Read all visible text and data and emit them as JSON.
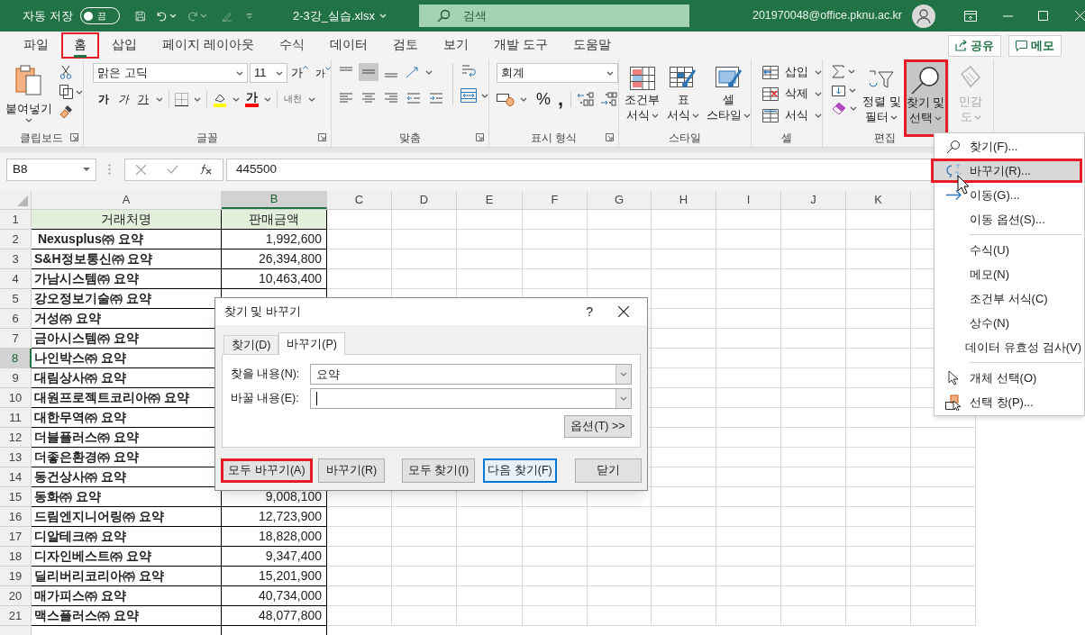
{
  "title_bar": {
    "autosave_label": "자동 저장",
    "autosave": {
      "on": false,
      "label": "끔"
    },
    "filename": "2-3강_실습.xlsx",
    "search": {
      "placeholder": "검색"
    },
    "account": "201970048@office.pknu.ac.kr"
  },
  "menu_tabs": [
    {
      "label": "파일",
      "selected": false,
      "highlighted": false
    },
    {
      "label": "홈",
      "selected": true,
      "highlighted": true
    },
    {
      "label": "삽입",
      "selected": false,
      "highlighted": false
    },
    {
      "label": "페이지 레이아웃",
      "selected": false,
      "highlighted": false
    },
    {
      "label": "수식",
      "selected": false,
      "highlighted": false
    },
    {
      "label": "데이터",
      "selected": false,
      "highlighted": false
    },
    {
      "label": "검토",
      "selected": false,
      "highlighted": false
    },
    {
      "label": "보기",
      "selected": false,
      "highlighted": false
    },
    {
      "label": "개발 도구",
      "selected": false,
      "highlighted": false
    },
    {
      "label": "도움말",
      "selected": false,
      "highlighted": false
    }
  ],
  "share_button": "공유",
  "comment_button": "메모",
  "ribbon": {
    "clipboard": {
      "paste": "붙여넣기",
      "group_label": "클립보드"
    },
    "font": {
      "font_name": "맑은 고딕",
      "font_size": "11",
      "grow": "가",
      "shrink": "가",
      "bold": "가",
      "italic": "가",
      "underline": "가",
      "font_color": "가",
      "phonetic": "내천",
      "group_label": "글꼴"
    },
    "alignment": {
      "group_label": "맞춤"
    },
    "number": {
      "format": "회계",
      "percent": "%",
      "comma": ",",
      "group_label": "표시 형식"
    },
    "styles": {
      "buttons": [
        {
          "lines": [
            "조건부",
            "서식"
          ]
        },
        {
          "lines": [
            "표",
            "서식"
          ]
        },
        {
          "lines": [
            "셀",
            "스타일"
          ]
        }
      ],
      "group_label": "스타일"
    },
    "cells": {
      "buttons": [
        {
          "kind": "insert",
          "label": "삽입"
        },
        {
          "kind": "delete",
          "label": "삭제"
        },
        {
          "kind": "format",
          "label": "서식"
        }
      ],
      "group_label": "셀"
    },
    "editing": {
      "sort_filter": {
        "lines": [
          "정렬 및",
          "필터"
        ]
      },
      "find_select": {
        "lines": [
          "찾기 및",
          "선택"
        ],
        "highlighted": true,
        "expanded": true
      },
      "group_label": "편집"
    },
    "sensitivity": {
      "lines": [
        "민감",
        "도"
      ],
      "disabled": true
    }
  },
  "formula_bar": {
    "name_box": "B8",
    "formula": "445500"
  },
  "sheet": {
    "columns": [
      {
        "label": "A",
        "selected": false
      },
      {
        "label": "B",
        "selected": true
      },
      {
        "label": "C",
        "selected": false
      },
      {
        "label": "D",
        "selected": false
      },
      {
        "label": "E",
        "selected": false
      },
      {
        "label": "F",
        "selected": false
      },
      {
        "label": "G",
        "selected": false
      },
      {
        "label": "H",
        "selected": false
      },
      {
        "label": "I",
        "selected": false
      },
      {
        "label": "J",
        "selected": false
      },
      {
        "label": "K",
        "selected": false
      }
    ],
    "rows": [
      {
        "number": "1",
        "selected": false,
        "kind": "header",
        "cells": [
          "거래처명",
          "판매금액"
        ]
      },
      {
        "number": "2",
        "selected": false,
        "kind": "data",
        "cells": [
          " Nexusplus㈜ 요약",
          "1,992,600"
        ]
      },
      {
        "number": "3",
        "selected": false,
        "kind": "data",
        "cells": [
          "S&H정보통신㈜ 요약",
          "26,394,800"
        ]
      },
      {
        "number": "4",
        "selected": false,
        "kind": "data",
        "cells": [
          "가남시스템㈜ 요약",
          "10,463,400"
        ]
      },
      {
        "number": "5",
        "selected": false,
        "kind": "data",
        "cells": [
          "강오정보기술㈜ 요약"
        ]
      },
      {
        "number": "6",
        "selected": false,
        "kind": "data",
        "cells": [
          "거성㈜ 요약"
        ]
      },
      {
        "number": "7",
        "selected": false,
        "kind": "data",
        "cells": [
          "금아시스템㈜ 요약"
        ]
      },
      {
        "number": "8",
        "selected": true,
        "kind": "data",
        "cells": [
          "나인박스㈜ 요약"
        ]
      },
      {
        "number": "9",
        "selected": false,
        "kind": "data",
        "cells": [
          "대림상사㈜ 요약"
        ]
      },
      {
        "number": "10",
        "selected": false,
        "kind": "data",
        "cells": [
          "대원프로젝트코리아㈜ 요약"
        ]
      },
      {
        "number": "11",
        "selected": false,
        "kind": "data",
        "cells": [
          "대한무역㈜ 요약"
        ]
      },
      {
        "number": "12",
        "selected": false,
        "kind": "data",
        "cells": [
          "더블플러스㈜ 요약"
        ]
      },
      {
        "number": "13",
        "selected": false,
        "kind": "data",
        "cells": [
          "더좋은환경㈜ 요약"
        ]
      },
      {
        "number": "14",
        "selected": false,
        "kind": "data",
        "cells": [
          "동건상사㈜ 요약"
        ]
      },
      {
        "number": "15",
        "selected": false,
        "kind": "data",
        "cells": [
          "동화㈜ 요약",
          "9,008,100"
        ]
      },
      {
        "number": "16",
        "selected": false,
        "kind": "data",
        "cells": [
          "드림엔지니어링㈜ 요약",
          "12,723,900"
        ]
      },
      {
        "number": "17",
        "selected": false,
        "kind": "data",
        "cells": [
          "디알테크㈜ 요약",
          "18,828,000"
        ]
      },
      {
        "number": "18",
        "selected": false,
        "kind": "data",
        "cells": [
          "디자인베스트㈜ 요약",
          "9,347,400"
        ]
      },
      {
        "number": "19",
        "selected": false,
        "kind": "data",
        "cells": [
          "딜리버리코리아㈜ 요약",
          "15,201,900"
        ]
      },
      {
        "number": "20",
        "selected": false,
        "kind": "data",
        "cells": [
          "매가피스㈜ 요약",
          "40,734,000"
        ]
      },
      {
        "number": "21",
        "selected": false,
        "kind": "data",
        "cells": [
          "맥스플러스㈜ 요약",
          "48,077,800"
        ]
      }
    ]
  },
  "find_menu": {
    "sections": [
      [
        {
          "kind": "search",
          "label": "찾기(F)...",
          "selected": false,
          "highlighted": false
        },
        {
          "kind": "replace",
          "label": "바꾸기(R)...",
          "selected": true,
          "highlighted": true
        },
        {
          "kind": "goto",
          "label": "이동(G)...",
          "selected": false,
          "highlighted": false
        },
        {
          "kind": "plain",
          "label": "이동 옵션(S)...",
          "selected": false,
          "highlighted": false
        }
      ],
      [
        {
          "kind": "plain",
          "label": "수식(U)",
          "selected": false,
          "highlighted": false
        },
        {
          "kind": "plain",
          "label": "메모(N)",
          "selected": false,
          "highlighted": false
        },
        {
          "kind": "plain",
          "label": "조건부 서식(C)",
          "selected": false,
          "highlighted": false
        },
        {
          "kind": "plain",
          "label": "상수(N)",
          "selected": false,
          "highlighted": false
        },
        {
          "kind": "plain",
          "label": "데이터 유효성 검사(V)",
          "selected": false,
          "highlighted": false
        }
      ],
      [
        {
          "kind": "select",
          "label": "개체 선택(O)",
          "selected": false,
          "highlighted": false
        },
        {
          "kind": "pane",
          "label": "선택 창(P)...",
          "selected": false,
          "highlighted": false
        }
      ]
    ]
  },
  "dialog": {
    "title": "찾기 및 바꾸기",
    "help": "?",
    "tabs": [
      {
        "label": "찾기(D)",
        "selected": false
      },
      {
        "label": "바꾸기(P)",
        "selected": true
      }
    ],
    "fields": [
      {
        "label": "찾을 내용(N):",
        "value": "요약",
        "focused": false
      },
      {
        "label": "바꿀 내용(E):",
        "focused": true
      }
    ],
    "options_button": "옵션(T) >>",
    "buttons": [
      {
        "label": "모두 바꾸기(A)",
        "highlighted": true,
        "default": false
      },
      {
        "label": "바꾸기(R)",
        "highlighted": false,
        "default": false
      },
      {
        "label": "모두 찾기(I)",
        "highlighted": false,
        "default": false
      },
      {
        "label": "다음 찾기(F)",
        "highlighted": false,
        "default": true
      },
      {
        "label": "닫기",
        "highlighted": false,
        "default": false
      }
    ]
  }
}
